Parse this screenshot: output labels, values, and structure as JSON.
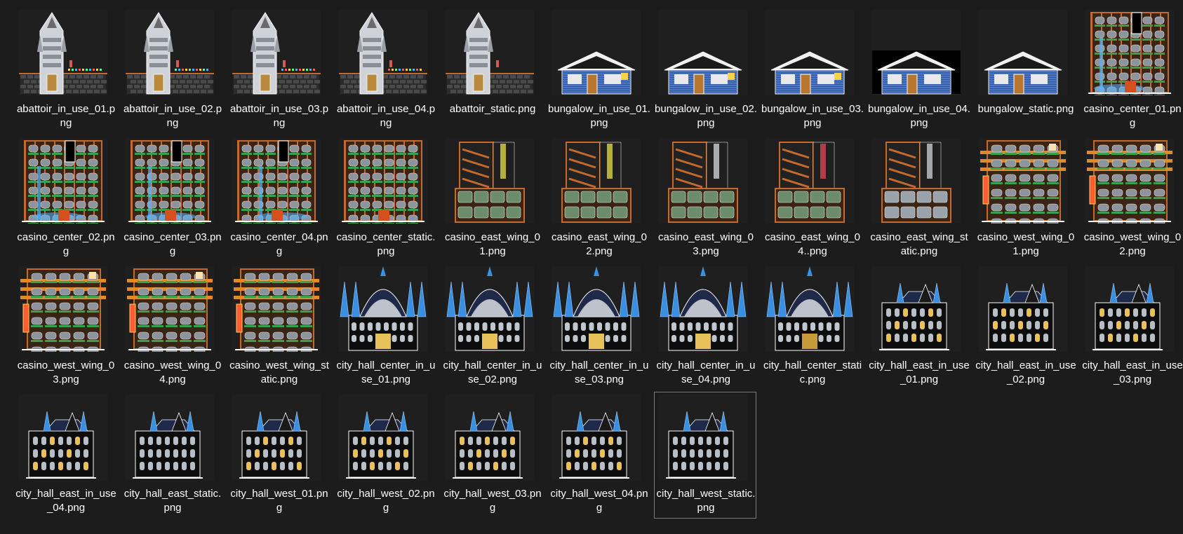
{
  "files": [
    {
      "name": "abattoir_in_use_01.png",
      "kind": "abattoir",
      "variant": 1,
      "selected": false
    },
    {
      "name": "abattoir_in_use_02.png",
      "kind": "abattoir",
      "variant": 2,
      "selected": false
    },
    {
      "name": "abattoir_in_use_03.png",
      "kind": "abattoir",
      "variant": 3,
      "selected": false
    },
    {
      "name": "abattoir_in_use_04.png",
      "kind": "abattoir",
      "variant": 4,
      "selected": false
    },
    {
      "name": "abattoir_static.png",
      "kind": "abattoir",
      "variant": 0,
      "selected": false
    },
    {
      "name": "bungalow_in_use_01.png",
      "kind": "bungalow",
      "variant": 1,
      "selected": false
    },
    {
      "name": "bungalow_in_use_02.png",
      "kind": "bungalow",
      "variant": 2,
      "selected": false
    },
    {
      "name": "bungalow_in_use_03.png",
      "kind": "bungalow",
      "variant": 3,
      "selected": false
    },
    {
      "name": "bungalow_in_use_04.png",
      "kind": "bungalow",
      "variant": 4,
      "selected": false
    },
    {
      "name": "bungalow_static.png",
      "kind": "bungalow",
      "variant": 0,
      "selected": false
    },
    {
      "name": "casino_center_01.png",
      "kind": "casino_center",
      "variant": 1,
      "selected": false
    },
    {
      "name": "casino_center_02.png",
      "kind": "casino_center",
      "variant": 2,
      "selected": false
    },
    {
      "name": "casino_center_03.png",
      "kind": "casino_center",
      "variant": 3,
      "selected": false
    },
    {
      "name": "casino_center_04.png",
      "kind": "casino_center",
      "variant": 4,
      "selected": false
    },
    {
      "name": "casino_center_static.png",
      "kind": "casino_center",
      "variant": 0,
      "selected": false
    },
    {
      "name": "casino_east_wing_01.png",
      "kind": "casino_east",
      "variant": 1,
      "selected": false
    },
    {
      "name": "casino_east_wing_02.png",
      "kind": "casino_east",
      "variant": 2,
      "selected": false
    },
    {
      "name": "casino_east_wing_03.png",
      "kind": "casino_east",
      "variant": 3,
      "selected": false
    },
    {
      "name": "casino_east_wing_04..png",
      "kind": "casino_east",
      "variant": 4,
      "selected": false
    },
    {
      "name": "casino_east_wing_static.png",
      "kind": "casino_east",
      "variant": 0,
      "selected": false
    },
    {
      "name": "casino_west_wing_01.png",
      "kind": "casino_west",
      "variant": 1,
      "selected": false
    },
    {
      "name": "casino_west_wing_02.png",
      "kind": "casino_west",
      "variant": 2,
      "selected": false
    },
    {
      "name": "casino_west_wing_03.png",
      "kind": "casino_west",
      "variant": 3,
      "selected": false
    },
    {
      "name": "casino_west_wing_04.png",
      "kind": "casino_west",
      "variant": 4,
      "selected": false
    },
    {
      "name": "casino_west_wing_static.png",
      "kind": "casino_west",
      "variant": 0,
      "selected": false
    },
    {
      "name": "city_hall_center_in_use_01.png",
      "kind": "city_hall_center",
      "variant": 1,
      "selected": false
    },
    {
      "name": "city_hall_center_in_use_02.png",
      "kind": "city_hall_center",
      "variant": 2,
      "selected": false
    },
    {
      "name": "city_hall_center_in_use_03.png",
      "kind": "city_hall_center",
      "variant": 3,
      "selected": false
    },
    {
      "name": "city_hall_center_in_use_04.png",
      "kind": "city_hall_center",
      "variant": 4,
      "selected": false
    },
    {
      "name": "city_hall_center_static.png",
      "kind": "city_hall_center",
      "variant": 0,
      "selected": false
    },
    {
      "name": "city_hall_east_in_use_01.png",
      "kind": "city_hall_wing",
      "variant": 1,
      "selected": false
    },
    {
      "name": "city_hall_east_in_use_02.png",
      "kind": "city_hall_wing",
      "variant": 2,
      "selected": false
    },
    {
      "name": "city_hall_east_in_use_03.png",
      "kind": "city_hall_wing",
      "variant": 3,
      "selected": false
    },
    {
      "name": "city_hall_east_in_use_04.png",
      "kind": "city_hall_wing",
      "variant": 4,
      "selected": false
    },
    {
      "name": "city_hall_east_static.png",
      "kind": "city_hall_wing",
      "variant": 0,
      "selected": false
    },
    {
      "name": "city_hall_west_01.png",
      "kind": "city_hall_wing",
      "variant": 1,
      "selected": false
    },
    {
      "name": "city_hall_west_02.png",
      "kind": "city_hall_wing",
      "variant": 2,
      "selected": false
    },
    {
      "name": "city_hall_west_03.png",
      "kind": "city_hall_wing",
      "variant": 3,
      "selected": false
    },
    {
      "name": "city_hall_west_04.png",
      "kind": "city_hall_wing",
      "variant": 4,
      "selected": false
    },
    {
      "name": "city_hall_west_static.png",
      "kind": "city_hall_wing",
      "variant": 0,
      "selected": true
    }
  ],
  "colors": {
    "background": "#1c1c1c",
    "text": "#ffffff",
    "selection_border": "#7a7a7a",
    "brick": "#c56a2c",
    "window_gold": "#e8c15a",
    "stone": "#cfd3d8",
    "spire_blue": "#3a8fe0",
    "roof_dark": "#1f2a4a",
    "bungalow_blue": "#2f5aa8"
  }
}
